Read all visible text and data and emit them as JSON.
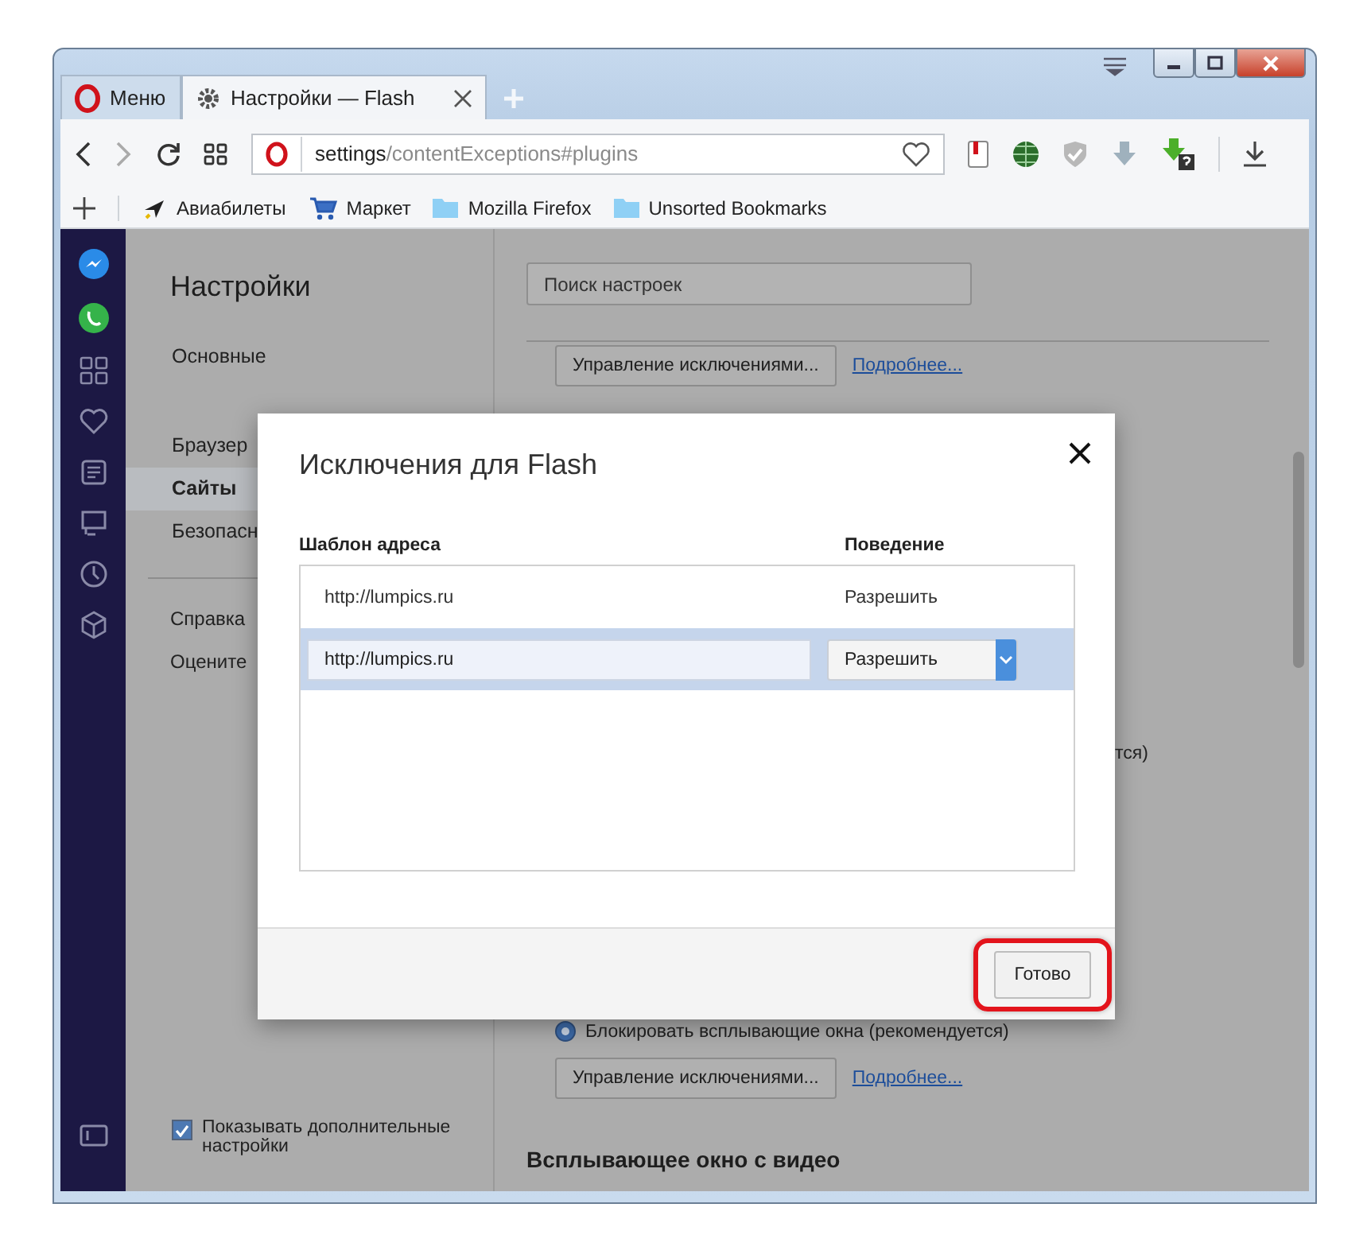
{
  "window": {
    "tabs": [
      {
        "kind": "menu",
        "label": "Меню",
        "selected": false
      },
      {
        "kind": "page",
        "label": "Настройки — Flash",
        "selected": true
      }
    ]
  },
  "address_bar": {
    "host": "settings",
    "path": "/contentExceptions#plugins"
  },
  "bookmarks": [
    {
      "kind": "plane",
      "label": "Авиабилеты"
    },
    {
      "kind": "cart",
      "label": "Маркет"
    },
    {
      "kind": "folder",
      "label": "Mozilla Firefox"
    },
    {
      "kind": "folder",
      "label": "Unsorted Bookmarks"
    }
  ],
  "settings_nav": {
    "title": "Настройки",
    "groups": [
      {
        "items": [
          {
            "label": "Основные",
            "selected": false
          }
        ]
      },
      {
        "items": [
          {
            "label": "Браузер",
            "selected": false
          },
          {
            "label": "Сайты",
            "selected": true
          },
          {
            "label": "Безопасн",
            "selected": false
          }
        ]
      }
    ],
    "links": [
      "Справка",
      "Оцените"
    ],
    "more_settings": {
      "label": "Показывать дополнительные настройки",
      "checked": true
    }
  },
  "main": {
    "search": {
      "placeholder": "Поиск настроек"
    },
    "top_actions": {
      "button": "Управление исключениями...",
      "link": "Подробнее..."
    },
    "covered_text_end": "тся)",
    "popup_option": {
      "label": "Блокировать всплывающие окна (рекомендуется)",
      "selected": true
    },
    "bottom_actions": {
      "button": "Управление исключениями...",
      "link": "Подробнее..."
    },
    "section_heading": "Всплывающее окно с видео"
  },
  "dialog": {
    "title": "Исключения для Flash",
    "columns": [
      "Шаблон адреса",
      "Поведение"
    ],
    "rows": [
      {
        "pattern": "http://lumpics.ru",
        "behavior": "Разрешить",
        "selected": false,
        "editing": false
      },
      {
        "pattern": "http://lumpics.ru",
        "behavior": "Разрешить",
        "selected": true,
        "editing": true
      }
    ],
    "done_button": "Готово"
  }
}
